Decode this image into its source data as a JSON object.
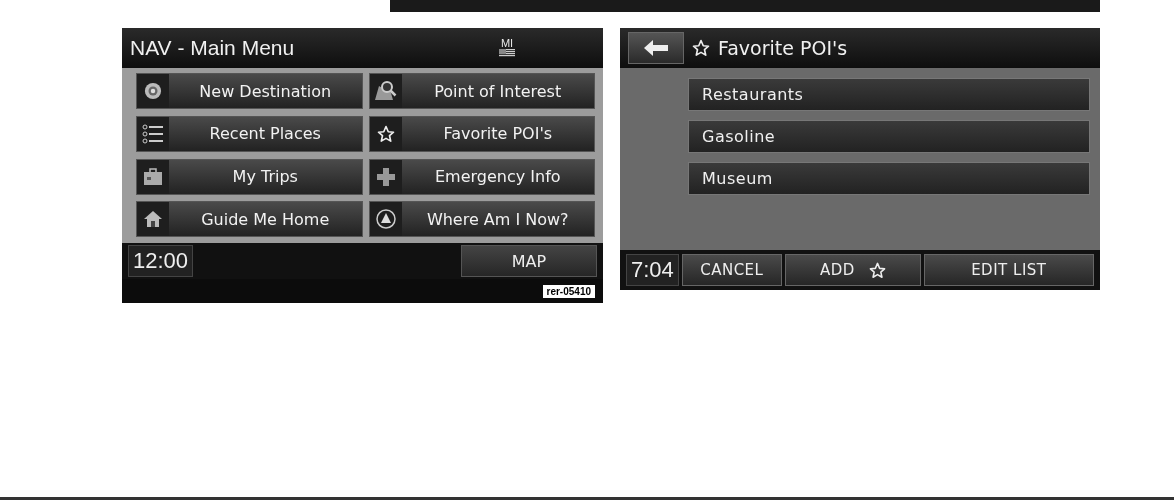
{
  "main_menu_screen": {
    "title": "NAV - Main Menu",
    "units": "MI",
    "items": [
      {
        "label": "New Destination"
      },
      {
        "label": "Point of Interest"
      },
      {
        "label": "Recent Places"
      },
      {
        "label": "Favorite POI's"
      },
      {
        "label": "My Trips"
      },
      {
        "label": "Emergency Info"
      },
      {
        "label": "Guide Me Home"
      },
      {
        "label": "Where Am I Now?"
      }
    ],
    "clock": "12:00",
    "map_button": "MAP",
    "figure_label": "rer-05410"
  },
  "favorites_screen": {
    "title": "Favorite POI's",
    "items": [
      {
        "label": "Restaurants"
      },
      {
        "label": "Gasoline"
      },
      {
        "label": "Museum"
      }
    ],
    "clock": "7:04",
    "buttons": [
      {
        "label": "CANCEL",
        "kind": "text"
      },
      {
        "label": "ADD",
        "kind": "star"
      },
      {
        "label": "EDIT LIST",
        "kind": "text"
      }
    ]
  }
}
